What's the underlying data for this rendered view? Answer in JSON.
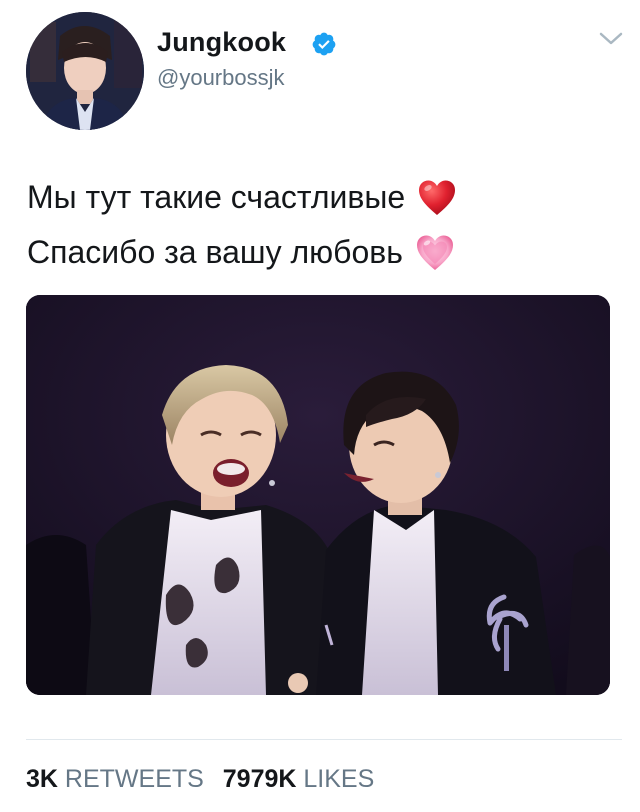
{
  "tweet": {
    "author": {
      "display_name": "Jungkook",
      "handle": "@yourbossjk",
      "verified": true,
      "avatar_icon": "profile-avatar"
    },
    "text_lines": [
      {
        "text": "Мы тут такие счастливые",
        "emoji": "red-heart-icon"
      },
      {
        "text": "Спасибо за вашу любовь",
        "emoji": "growing-heart-icon"
      }
    ],
    "media": {
      "type": "photo"
    },
    "stats": {
      "retweets_count": "3K",
      "retweets_label": "RETWEETS",
      "likes_count": "7979K",
      "likes_label": "LIKES"
    }
  },
  "colors": {
    "text_primary": "#14171a",
    "text_secondary": "#657786",
    "verified_blue": "#1da1f2",
    "heart_red": "#e0212f",
    "heart_pink": "#f47fb0",
    "divider": "#e1e8ed"
  }
}
